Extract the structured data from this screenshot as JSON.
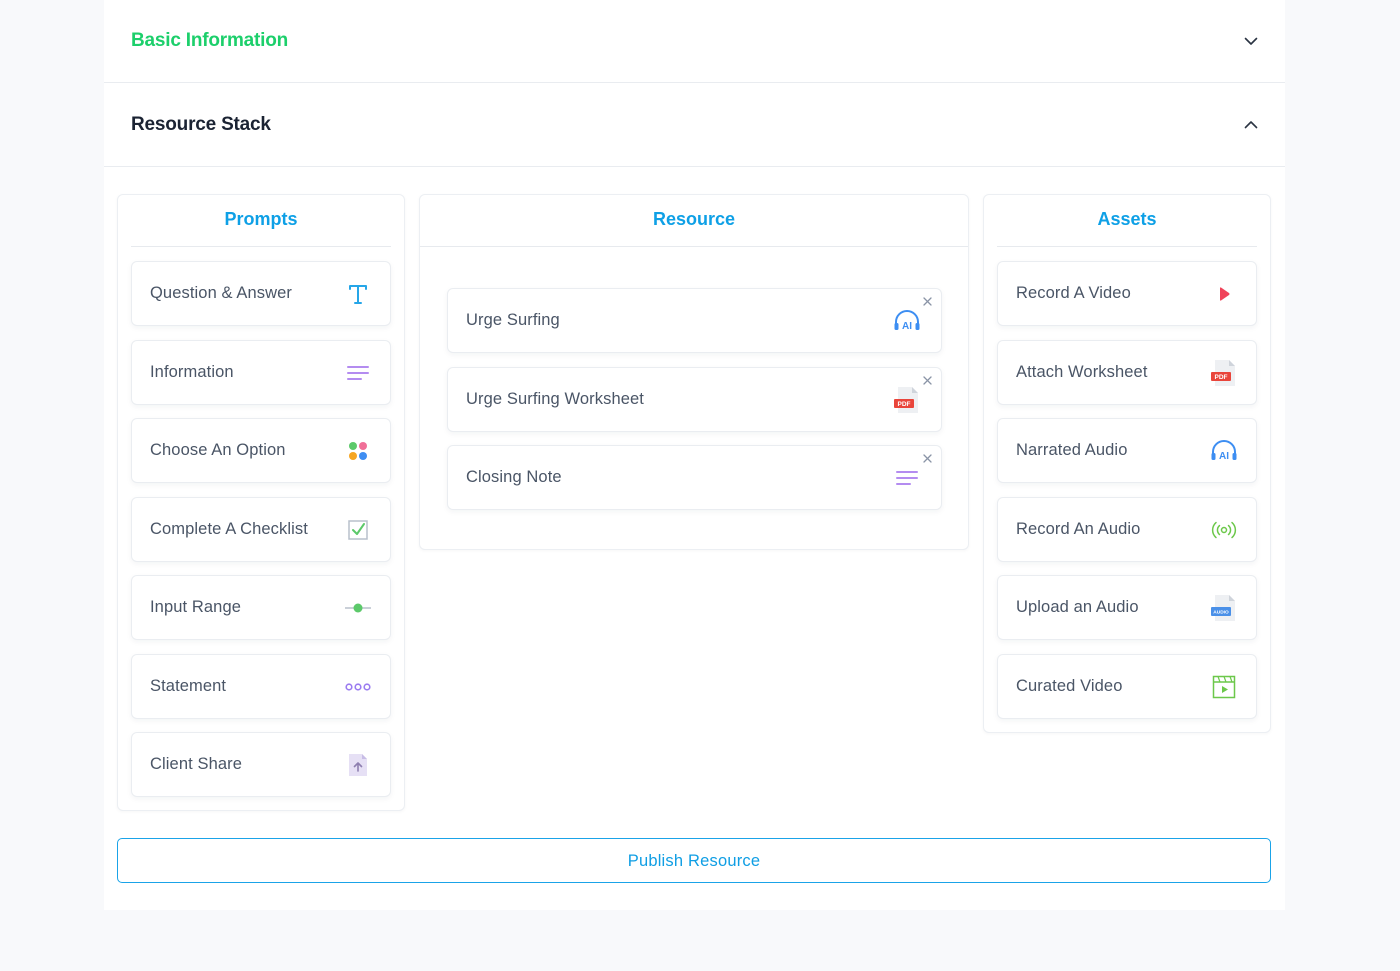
{
  "accordion": {
    "basic_info": "Basic Information",
    "resource_stack": "Resource Stack"
  },
  "prompts": {
    "title": "Prompts",
    "items": [
      {
        "label": "Question & Answer",
        "icon": "text-t-icon"
      },
      {
        "label": "Information",
        "icon": "lines-icon"
      },
      {
        "label": "Choose An Option",
        "icon": "dots-grid-icon"
      },
      {
        "label": "Complete A Checklist",
        "icon": "checkbox-icon"
      },
      {
        "label": "Input Range",
        "icon": "slider-icon"
      },
      {
        "label": "Statement",
        "icon": "ellipsis-icon"
      },
      {
        "label": "Client Share",
        "icon": "file-upload-icon"
      }
    ]
  },
  "resource": {
    "title": "Resource",
    "items": [
      {
        "label": "Urge Surfing",
        "icon": "ai-headphones-icon"
      },
      {
        "label": "Urge Surfing Worksheet",
        "icon": "pdf-file-icon"
      },
      {
        "label": "Closing Note",
        "icon": "lines-icon"
      }
    ]
  },
  "assets": {
    "title": "Assets",
    "items": [
      {
        "label": "Record A Video",
        "icon": "record-video-icon"
      },
      {
        "label": "Attach Worksheet",
        "icon": "pdf-file-icon"
      },
      {
        "label": "Narrated Audio",
        "icon": "ai-headphones-icon"
      },
      {
        "label": "Record An Audio",
        "icon": "broadcast-icon"
      },
      {
        "label": "Upload an Audio",
        "icon": "audio-file-icon"
      },
      {
        "label": "Curated Video",
        "icon": "video-clip-icon"
      }
    ]
  },
  "icon_text": {
    "ai": "AI",
    "pdf": "PDF",
    "audio": "AUDIO"
  },
  "publish_label": "Publish Resource",
  "colors": {
    "accent": "#0ea0e6",
    "green": "#1ccf6b",
    "purple": "#a78bfa",
    "red": "#f0435a"
  }
}
